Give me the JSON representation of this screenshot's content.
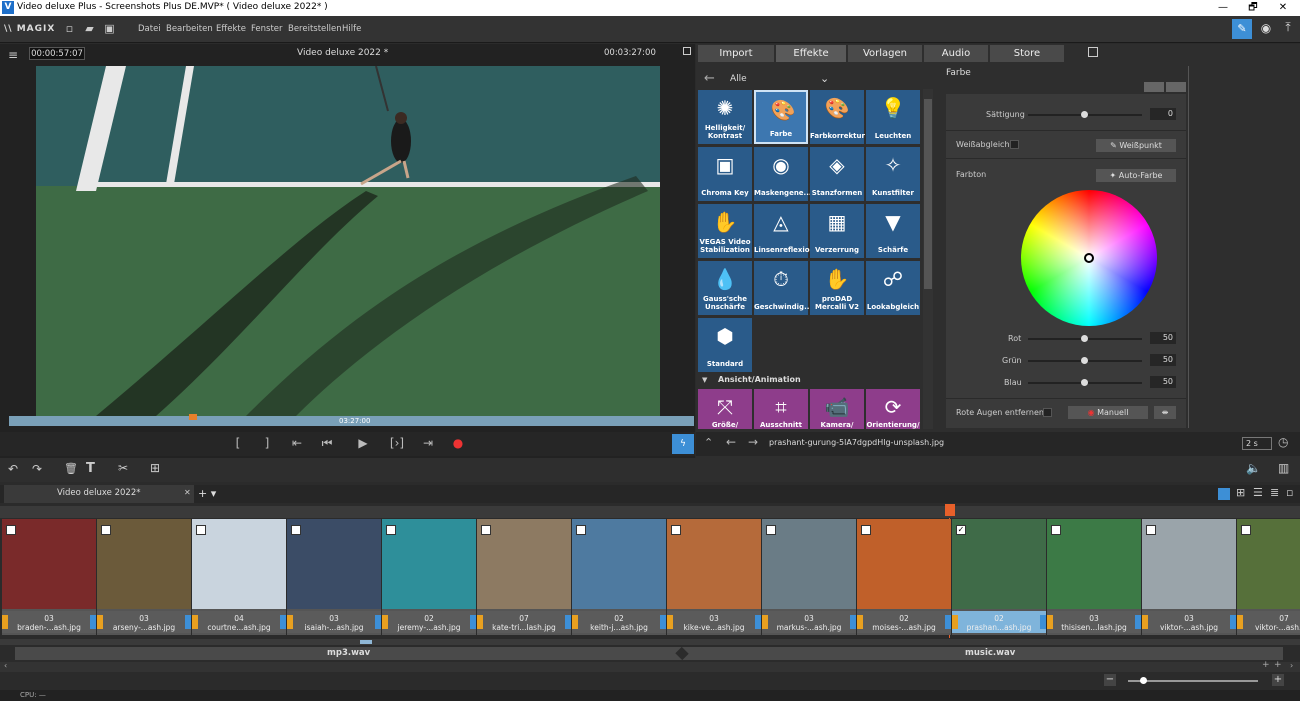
{
  "titlebar": {
    "title": "Video deluxe Plus - Screenshots Plus DE.MVP* ( Video deluxe 2022* )",
    "min": "—",
    "max": "🗗",
    "close": "✕"
  },
  "menu": {
    "logo": "\\\\ MAGIX",
    "items": [
      "Datei",
      "Bearbeiten",
      "Effekte",
      "Fenster",
      "Bereitstellen",
      "Hilfe"
    ]
  },
  "preview": {
    "time_left": "00:00:57:07",
    "title": "Video deluxe 2022 *",
    "time_right": "00:03:27:00",
    "scrub_time": "03:27:00"
  },
  "tabs": [
    "Import",
    "Effekte",
    "Vorlagen",
    "Audio",
    "Store"
  ],
  "effects": {
    "nav_label": "Alle",
    "tiles": [
      {
        "label": "Helligkeit/ Kontrast",
        "icon": "sun-icon"
      },
      {
        "label": "Farbe",
        "icon": "palette-icon"
      },
      {
        "label": "Farbkorrektur",
        "icon": "palette-brush-icon"
      },
      {
        "label": "Leuchten",
        "icon": "lightbulb-icon"
      },
      {
        "label": "Chroma Key",
        "icon": "chroma-key-icon"
      },
      {
        "label": "Maskengene...",
        "icon": "eye-icon"
      },
      {
        "label": "Stanzformen",
        "icon": "shape-icon"
      },
      {
        "label": "Kunstfilter",
        "icon": "sparkle-icon"
      },
      {
        "label": "VEGAS Video Stabilization",
        "icon": "hand-icon"
      },
      {
        "label": "Linsenreflexion",
        "icon": "lens-icon"
      },
      {
        "label": "Verzerrung",
        "icon": "grid-icon"
      },
      {
        "label": "Schärfe",
        "icon": "sharpness-icon"
      },
      {
        "label": "Gauss'sche Unschärfe",
        "icon": "drop-icon"
      },
      {
        "label": "Geschwindig...",
        "icon": "speed-icon"
      },
      {
        "label": "proDAD Mercalli V2",
        "icon": "hand-icon"
      },
      {
        "label": "Lookabgleich",
        "icon": "look-icon"
      },
      {
        "label": "Standard",
        "icon": "hexagon-icon"
      }
    ],
    "section": "Ansicht/Animation",
    "anim_tiles": [
      {
        "label": "Größe/",
        "icon": "resize-icon"
      },
      {
        "label": "Ausschnitt",
        "icon": "crop-icon"
      },
      {
        "label": "Kamera/",
        "icon": "camera-icon"
      },
      {
        "label": "Orientierung/",
        "icon": "rotate-icon"
      }
    ]
  },
  "settings": {
    "title": "Farbe",
    "saettigung": {
      "label": "Sättigung",
      "value": "0"
    },
    "weissabgleich": "Weißabgleich",
    "weisspunkt": "Weißpunkt",
    "farbton": "Farbton",
    "autofarbe": "Auto-Farbe",
    "rot": {
      "label": "Rot",
      "value": "50"
    },
    "gruen": {
      "label": "Grün",
      "value": "50"
    },
    "blau": {
      "label": "Blau",
      "value": "50"
    },
    "rote_augen": "Rote Augen entfernen",
    "manuell": "Manuell"
  },
  "status": {
    "filename": "prashant-gurung-5lA7dgpdHlg-unsplash.jpg",
    "duration": "2 s"
  },
  "project_tab": "Video deluxe 2022*",
  "clips": [
    {
      "num": "03",
      "name": "braden-...ash.jpg",
      "color": "#7a2a2a"
    },
    {
      "num": "03",
      "name": "arseny-...ash.jpg",
      "color": "#6b5a3a"
    },
    {
      "num": "04",
      "name": "courtne...ash.jpg",
      "color": "#c9d4de"
    },
    {
      "num": "03",
      "name": "isaiah-...ash.jpg",
      "color": "#3b4c66"
    },
    {
      "num": "02",
      "name": "jeremy-...ash.jpg",
      "color": "#2e8f9a"
    },
    {
      "num": "07",
      "name": "kate-tri...lash.jpg",
      "color": "#8d7a62"
    },
    {
      "num": "02",
      "name": "keith-j...ash.jpg",
      "color": "#4e7aa0"
    },
    {
      "num": "03",
      "name": "kike-ve...ash.jpg",
      "color": "#b56a3a"
    },
    {
      "num": "03",
      "name": "markus-...ash.jpg",
      "color": "#6a7c86"
    },
    {
      "num": "02",
      "name": "moises-...ash.jpg",
      "color": "#c0602a"
    },
    {
      "num": "02",
      "name": "prashan...ash.jpg",
      "color": "#3f6b48"
    },
    {
      "num": "03",
      "name": "thisisen...lash.jpg",
      "color": "#3c7a46"
    },
    {
      "num": "03",
      "name": "viktor-...ash.jpg",
      "color": "#9aa4aa"
    },
    {
      "num": "07",
      "name": "viktor-...ash.jpg",
      "color": "#56703a"
    }
  ],
  "audio": {
    "track1": "mp3.wav",
    "track2": "music.wav"
  },
  "cpu": "CPU: —"
}
